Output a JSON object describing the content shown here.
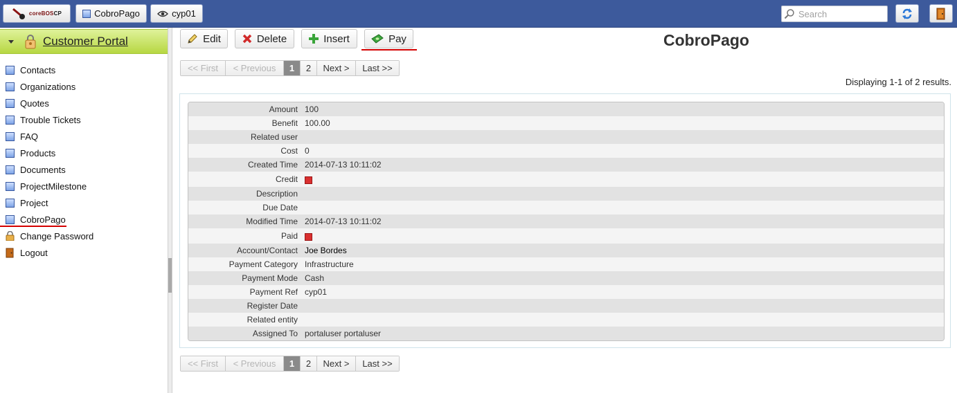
{
  "topbar": {
    "logo_text": "coreBOS",
    "logo_suffix": "CP",
    "tabs": [
      {
        "label": "CobroPago"
      },
      {
        "label": "cyp01"
      }
    ],
    "search_placeholder": "Search"
  },
  "sidebar": {
    "title": "Customer Portal",
    "items": [
      {
        "label": "Contacts"
      },
      {
        "label": "Organizations"
      },
      {
        "label": "Quotes"
      },
      {
        "label": "Trouble Tickets"
      },
      {
        "label": "FAQ"
      },
      {
        "label": "Products"
      },
      {
        "label": "Documents"
      },
      {
        "label": "ProjectMilestone"
      },
      {
        "label": "Project"
      },
      {
        "label": "CobroPago"
      },
      {
        "label": "Change Password"
      },
      {
        "label": "Logout"
      }
    ]
  },
  "toolbar": {
    "edit_label": "Edit",
    "delete_label": "Delete",
    "insert_label": "Insert",
    "pay_label": "Pay"
  },
  "record_title": "CobroPago",
  "pager": {
    "first": "<< First",
    "previous": "< Previous",
    "page1": "1",
    "page2": "2",
    "next": "Next >",
    "last": "Last >>"
  },
  "result_summary": "Displaying 1-1 of 2 results.",
  "fields": [
    {
      "label": "Amount",
      "value": "100"
    },
    {
      "label": "Benefit",
      "value": "100.00"
    },
    {
      "label": "Related user",
      "value": ""
    },
    {
      "label": "Cost",
      "value": "0"
    },
    {
      "label": "Created Time",
      "value": "2014-07-13 10:11:02"
    },
    {
      "label": "Credit",
      "value": ""
    },
    {
      "label": "Description",
      "value": ""
    },
    {
      "label": "Due Date",
      "value": ""
    },
    {
      "label": "Modified Time",
      "value": "2014-07-13 10:11:02"
    },
    {
      "label": "Paid",
      "value": ""
    },
    {
      "label": "Account/Contact",
      "value": "Joe Bordes"
    },
    {
      "label": "Payment Category",
      "value": "Infrastructure"
    },
    {
      "label": "Payment Mode",
      "value": "Cash"
    },
    {
      "label": "Payment Ref",
      "value": "cyp01"
    },
    {
      "label": "Register Date",
      "value": ""
    },
    {
      "label": "Related entity",
      "value": ""
    },
    {
      "label": "Assigned To",
      "value": "portaluser portaluser"
    }
  ],
  "checkbox_fields": {
    "credit": false,
    "paid": false
  },
  "colors": {
    "topbar": "#3d5a9c",
    "accent": "#d40000",
    "portal_header": "#c8e36a"
  }
}
